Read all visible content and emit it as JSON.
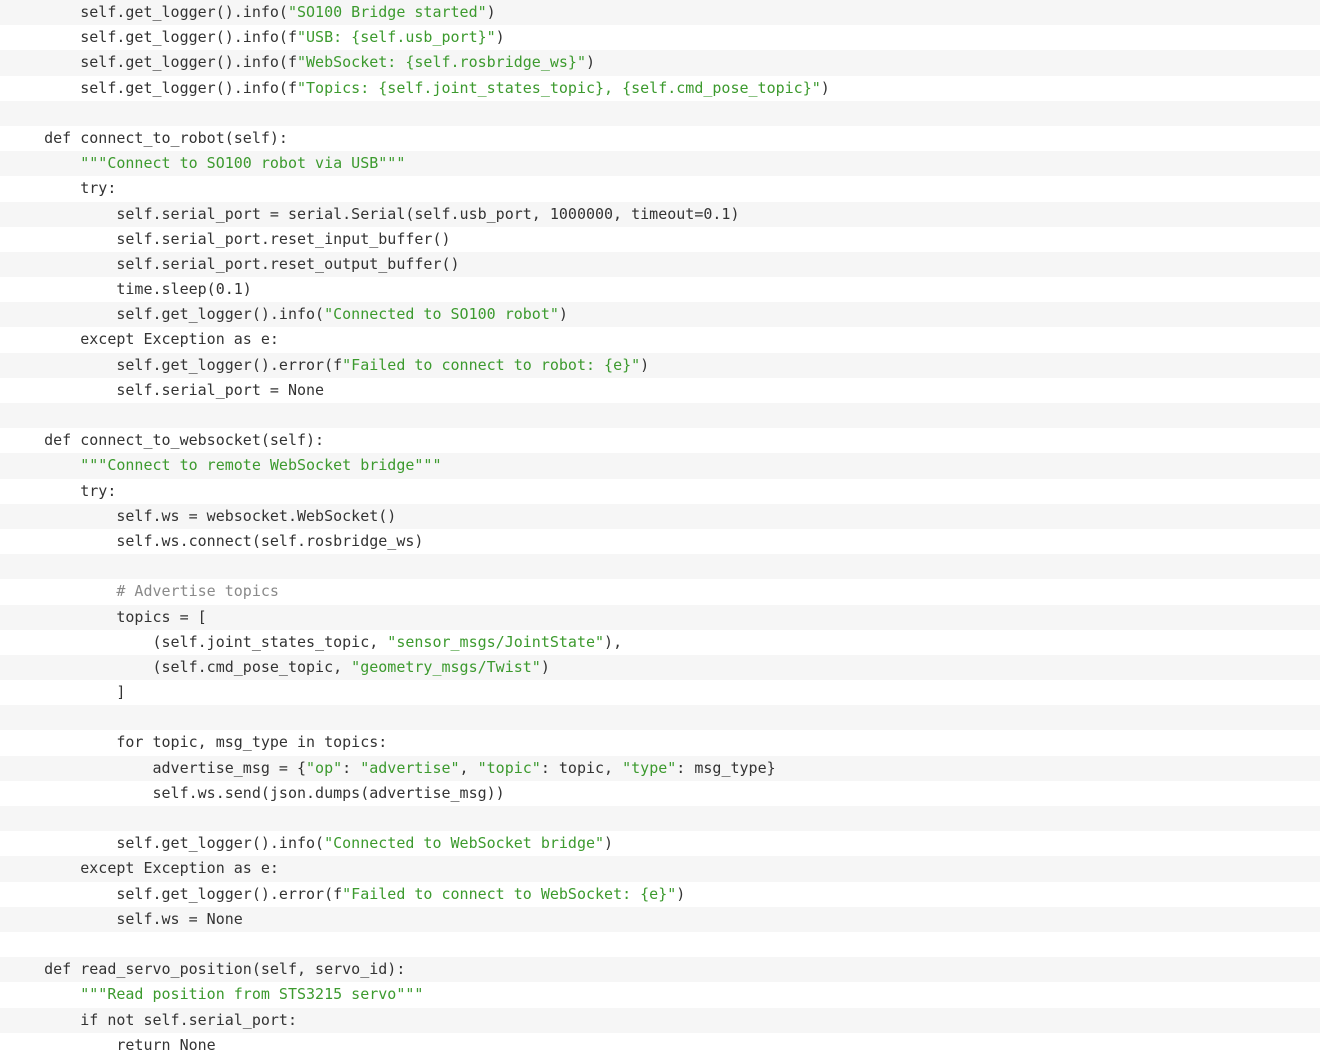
{
  "colors": {
    "background": "#ffffff",
    "stripe": "#f6f6f6",
    "text": "#333333",
    "string": "#3c9a2e",
    "comment": "#8a8a8a"
  },
  "code": {
    "language": "python",
    "lines": [
      [
        {
          "t": "        self.get_logger().info(",
          "k": "p"
        },
        {
          "t": "\"SO100 Bridge started\"",
          "k": "s"
        },
        {
          "t": ")",
          "k": "p"
        }
      ],
      [
        {
          "t": "        self.get_logger().info(f",
          "k": "p"
        },
        {
          "t": "\"USB: {self.usb_port}\"",
          "k": "s"
        },
        {
          "t": ")",
          "k": "p"
        }
      ],
      [
        {
          "t": "        self.get_logger().info(f",
          "k": "p"
        },
        {
          "t": "\"WebSocket: {self.rosbridge_ws}\"",
          "k": "s"
        },
        {
          "t": ")",
          "k": "p"
        }
      ],
      [
        {
          "t": "        self.get_logger().info(f",
          "k": "p"
        },
        {
          "t": "\"Topics: {self.joint_states_topic}, {self.cmd_pose_topic}\"",
          "k": "s"
        },
        {
          "t": ")",
          "k": "p"
        }
      ],
      [
        {
          "t": "",
          "k": "p"
        }
      ],
      [
        {
          "t": "    def connect_to_robot(self):",
          "k": "p"
        }
      ],
      [
        {
          "t": "        ",
          "k": "p"
        },
        {
          "t": "\"\"\"Connect to SO100 robot via USB\"\"\"",
          "k": "s"
        }
      ],
      [
        {
          "t": "        try:",
          "k": "p"
        }
      ],
      [
        {
          "t": "            self.serial_port = serial.Serial(self.usb_port, 1000000, timeout=0.1)",
          "k": "p"
        }
      ],
      [
        {
          "t": "            self.serial_port.reset_input_buffer()",
          "k": "p"
        }
      ],
      [
        {
          "t": "            self.serial_port.reset_output_buffer()",
          "k": "p"
        }
      ],
      [
        {
          "t": "            time.sleep(0.1)",
          "k": "p"
        }
      ],
      [
        {
          "t": "            self.get_logger().info(",
          "k": "p"
        },
        {
          "t": "\"Connected to SO100 robot\"",
          "k": "s"
        },
        {
          "t": ")",
          "k": "p"
        }
      ],
      [
        {
          "t": "        except Exception as e:",
          "k": "p"
        }
      ],
      [
        {
          "t": "            self.get_logger().error(f",
          "k": "p"
        },
        {
          "t": "\"Failed to connect to robot: {e}\"",
          "k": "s"
        },
        {
          "t": ")",
          "k": "p"
        }
      ],
      [
        {
          "t": "            self.serial_port = None",
          "k": "p"
        }
      ],
      [
        {
          "t": "",
          "k": "p"
        }
      ],
      [
        {
          "t": "    def connect_to_websocket(self):",
          "k": "p"
        }
      ],
      [
        {
          "t": "        ",
          "k": "p"
        },
        {
          "t": "\"\"\"Connect to remote WebSocket bridge\"\"\"",
          "k": "s"
        }
      ],
      [
        {
          "t": "        try:",
          "k": "p"
        }
      ],
      [
        {
          "t": "            self.ws = websocket.WebSocket()",
          "k": "p"
        }
      ],
      [
        {
          "t": "            self.ws.connect(self.rosbridge_ws)",
          "k": "p"
        }
      ],
      [
        {
          "t": "",
          "k": "p"
        }
      ],
      [
        {
          "t": "            ",
          "k": "p"
        },
        {
          "t": "# Advertise topics",
          "k": "c"
        }
      ],
      [
        {
          "t": "            topics = [",
          "k": "p"
        }
      ],
      [
        {
          "t": "                (self.joint_states_topic, ",
          "k": "p"
        },
        {
          "t": "\"sensor_msgs/JointState\"",
          "k": "s"
        },
        {
          "t": "),",
          "k": "p"
        }
      ],
      [
        {
          "t": "                (self.cmd_pose_topic, ",
          "k": "p"
        },
        {
          "t": "\"geometry_msgs/Twist\"",
          "k": "s"
        },
        {
          "t": ")",
          "k": "p"
        }
      ],
      [
        {
          "t": "            ]",
          "k": "p"
        }
      ],
      [
        {
          "t": "",
          "k": "p"
        }
      ],
      [
        {
          "t": "            for topic, msg_type in topics:",
          "k": "p"
        }
      ],
      [
        {
          "t": "                advertise_msg = {",
          "k": "p"
        },
        {
          "t": "\"op\"",
          "k": "s"
        },
        {
          "t": ": ",
          "k": "p"
        },
        {
          "t": "\"advertise\"",
          "k": "s"
        },
        {
          "t": ", ",
          "k": "p"
        },
        {
          "t": "\"topic\"",
          "k": "s"
        },
        {
          "t": ": topic, ",
          "k": "p"
        },
        {
          "t": "\"type\"",
          "k": "s"
        },
        {
          "t": ": msg_type}",
          "k": "p"
        }
      ],
      [
        {
          "t": "                self.ws.send(json.dumps(advertise_msg))",
          "k": "p"
        }
      ],
      [
        {
          "t": "",
          "k": "p"
        }
      ],
      [
        {
          "t": "            self.get_logger().info(",
          "k": "p"
        },
        {
          "t": "\"Connected to WebSocket bridge\"",
          "k": "s"
        },
        {
          "t": ")",
          "k": "p"
        }
      ],
      [
        {
          "t": "        except Exception as e:",
          "k": "p"
        }
      ],
      [
        {
          "t": "            self.get_logger().error(f",
          "k": "p"
        },
        {
          "t": "\"Failed to connect to WebSocket: {e}\"",
          "k": "s"
        },
        {
          "t": ")",
          "k": "p"
        }
      ],
      [
        {
          "t": "            self.ws = None",
          "k": "p"
        }
      ],
      [
        {
          "t": "",
          "k": "p"
        }
      ],
      [
        {
          "t": "    def read_servo_position(self, servo_id):",
          "k": "p"
        }
      ],
      [
        {
          "t": "        ",
          "k": "p"
        },
        {
          "t": "\"\"\"Read position from STS3215 servo\"\"\"",
          "k": "s"
        }
      ],
      [
        {
          "t": "        if not self.serial_port:",
          "k": "p"
        }
      ],
      [
        {
          "t": "            return None",
          "k": "p"
        }
      ]
    ]
  }
}
